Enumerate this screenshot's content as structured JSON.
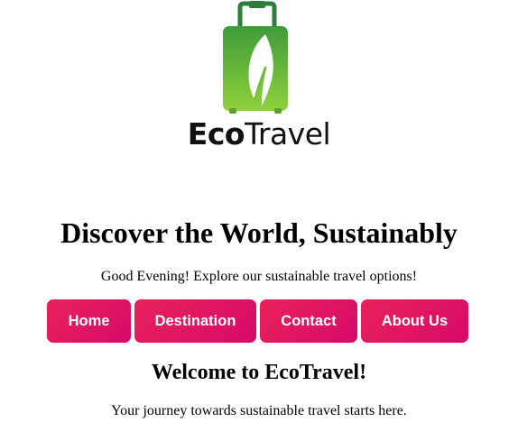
{
  "brand": {
    "name_bold": "Eco",
    "name_regular": "Travel",
    "logo_icon": "suitcase-leaf-icon",
    "colors": {
      "handle": "#2f7d3a",
      "bag_top": "#3f9b3a",
      "bag_bottom": "#8fd13a",
      "leaf": "#ffffff"
    }
  },
  "hero": {
    "headline": "Discover the World, Sustainably",
    "greeting": "Good Evening! Explore our sustainable travel options!"
  },
  "nav": {
    "accent_color": "#e0185f",
    "items": [
      {
        "label": "Home"
      },
      {
        "label": "Destination"
      },
      {
        "label": "Contact"
      },
      {
        "label": "About Us"
      }
    ]
  },
  "welcome": {
    "title": "Welcome to EcoTravel!",
    "text": "Your journey towards sustainable travel starts here."
  }
}
